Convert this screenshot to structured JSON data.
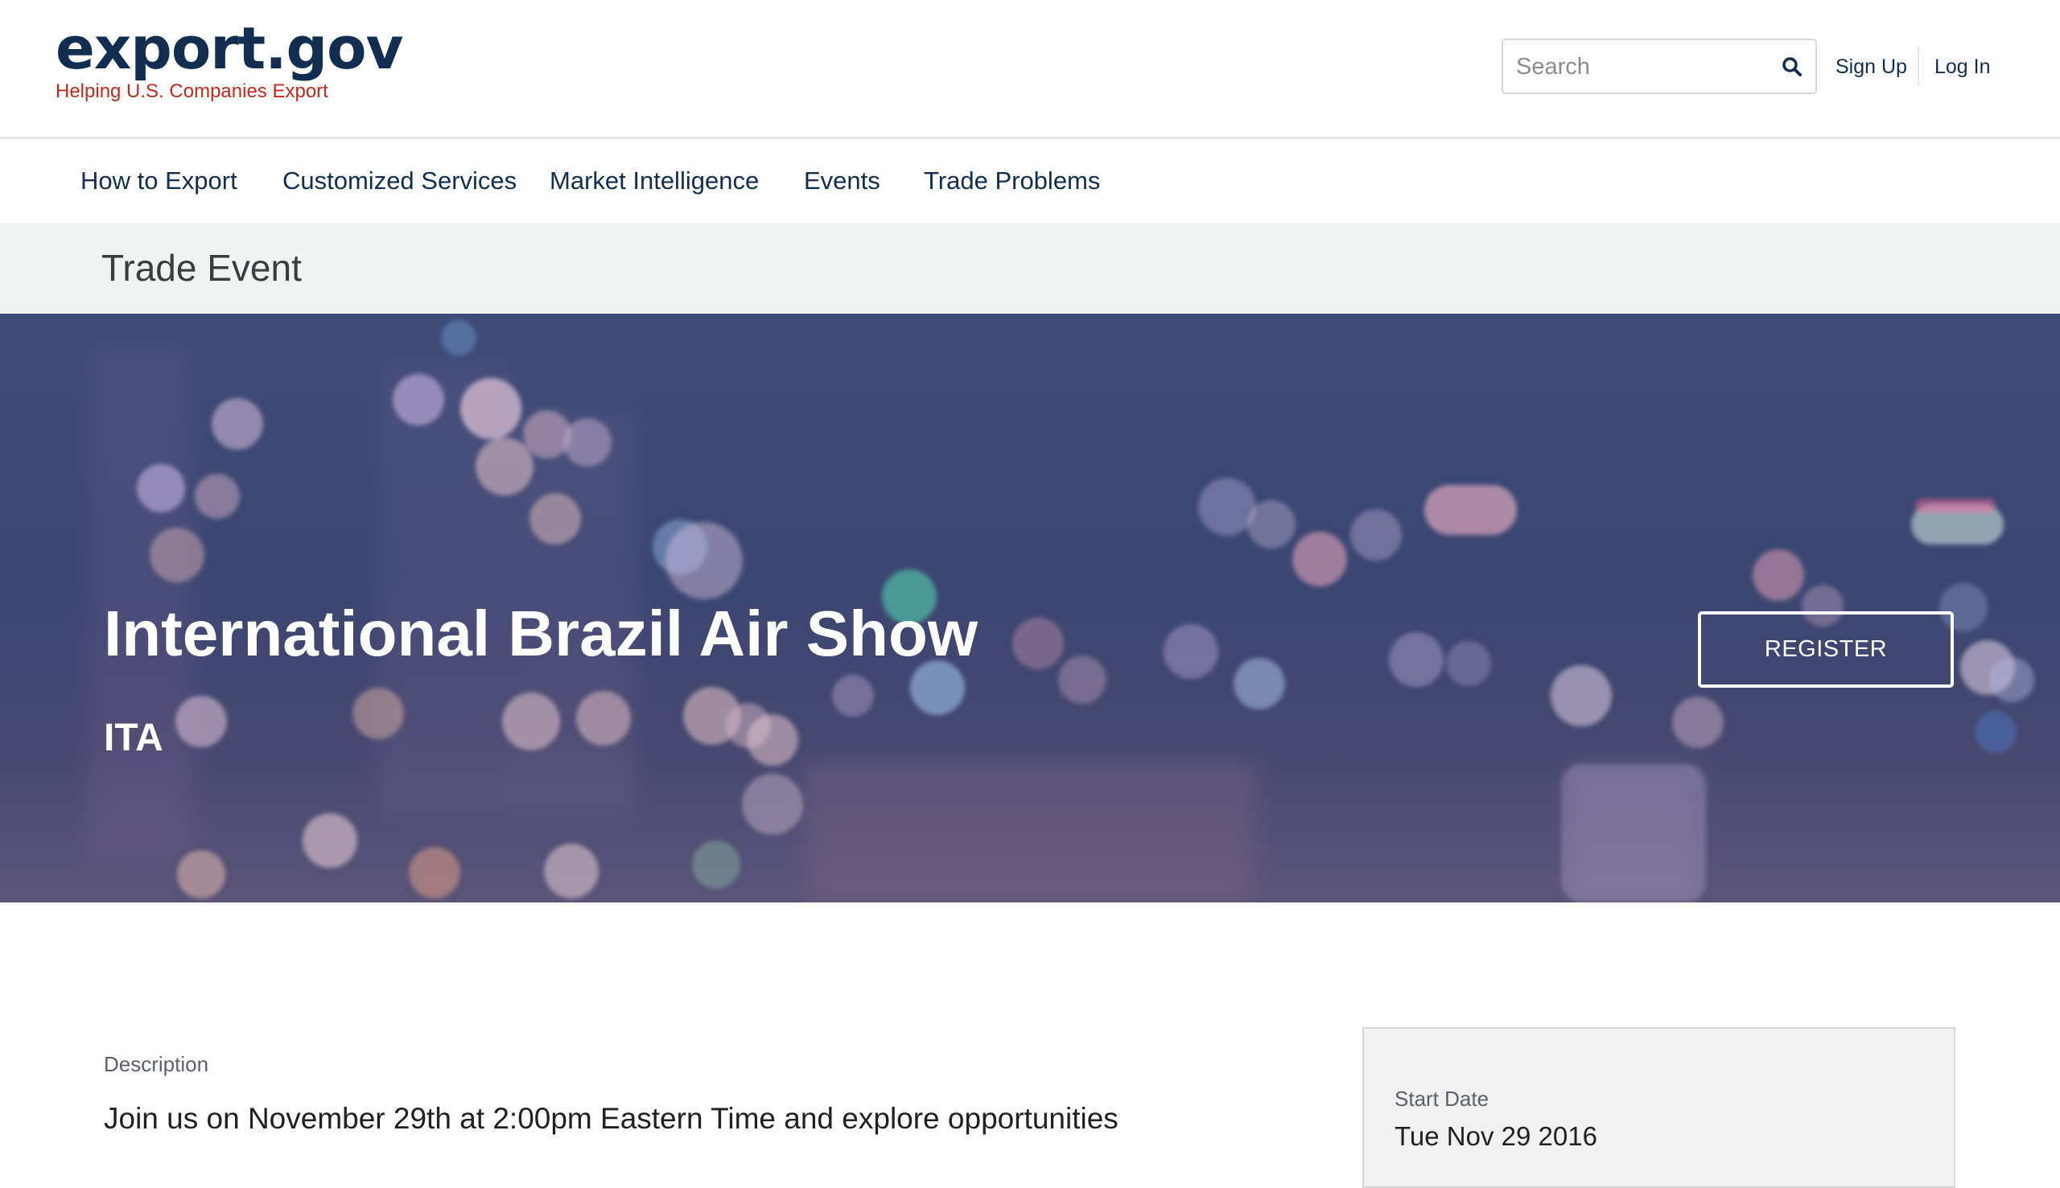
{
  "header": {
    "logo_text": "export.gov",
    "tagline": "Helping U.S. Companies Export",
    "search_placeholder": "Search",
    "sign_up": "Sign Up",
    "log_in": "Log In"
  },
  "nav": {
    "items": [
      {
        "label": "How to Export"
      },
      {
        "label": "Customized Services"
      },
      {
        "label": "Market Intelligence"
      },
      {
        "label": "Events"
      },
      {
        "label": "Trade Problems"
      }
    ]
  },
  "page": {
    "section_title": "Trade Event"
  },
  "hero": {
    "title": "International Brazil Air Show",
    "organizer": "ITA",
    "register_label": "REGISTER"
  },
  "content": {
    "description_label": "Description",
    "description_text": "Join us on November 29th at 2:00pm Eastern Time and explore opportunities"
  },
  "details": {
    "start_date_label": "Start Date",
    "start_date_value": "Tue Nov 29 2016"
  },
  "colors": {
    "brand_navy": "#112e51",
    "tagline_red": "#c5281c",
    "hero_overlay": "#3e4a78"
  },
  "icons": {
    "search": "search-icon"
  }
}
